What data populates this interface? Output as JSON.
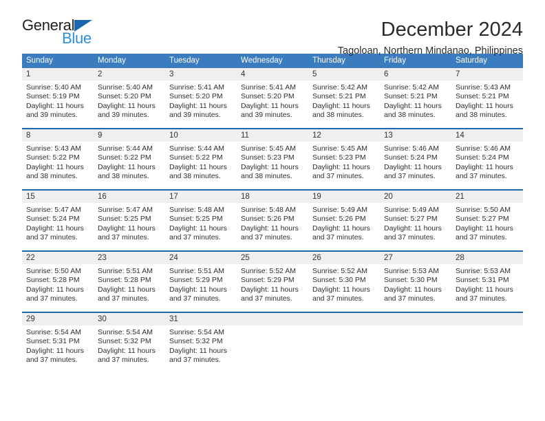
{
  "brand": {
    "name_top": "General",
    "name_bottom": "Blue",
    "triangle_icon": "triangle-icon",
    "color_dark": "#231f20",
    "color_blue": "#2c8fd4",
    "color_triangle": "#1c66ad"
  },
  "header": {
    "title": "December 2024",
    "subtitle": "Tagoloan, Northern Mindanao, Philippines"
  },
  "theme": {
    "header_bg": "#3a7cbd",
    "header_text": "#ffffff",
    "row_rule": "#1c66ad",
    "daynum_bg": "#efefef",
    "cell_bg": "#ffffff"
  },
  "calendar": {
    "weekdays": [
      "Sunday",
      "Monday",
      "Tuesday",
      "Wednesday",
      "Thursday",
      "Friday",
      "Saturday"
    ],
    "weeks": [
      [
        {
          "day": "1",
          "sunrise": "Sunrise: 5:40 AM",
          "sunset": "Sunset: 5:19 PM",
          "daylight_1": "Daylight: 11 hours",
          "daylight_2": "and 39 minutes."
        },
        {
          "day": "2",
          "sunrise": "Sunrise: 5:40 AM",
          "sunset": "Sunset: 5:20 PM",
          "daylight_1": "Daylight: 11 hours",
          "daylight_2": "and 39 minutes."
        },
        {
          "day": "3",
          "sunrise": "Sunrise: 5:41 AM",
          "sunset": "Sunset: 5:20 PM",
          "daylight_1": "Daylight: 11 hours",
          "daylight_2": "and 39 minutes."
        },
        {
          "day": "4",
          "sunrise": "Sunrise: 5:41 AM",
          "sunset": "Sunset: 5:20 PM",
          "daylight_1": "Daylight: 11 hours",
          "daylight_2": "and 39 minutes."
        },
        {
          "day": "5",
          "sunrise": "Sunrise: 5:42 AM",
          "sunset": "Sunset: 5:21 PM",
          "daylight_1": "Daylight: 11 hours",
          "daylight_2": "and 38 minutes."
        },
        {
          "day": "6",
          "sunrise": "Sunrise: 5:42 AM",
          "sunset": "Sunset: 5:21 PM",
          "daylight_1": "Daylight: 11 hours",
          "daylight_2": "and 38 minutes."
        },
        {
          "day": "7",
          "sunrise": "Sunrise: 5:43 AM",
          "sunset": "Sunset: 5:21 PM",
          "daylight_1": "Daylight: 11 hours",
          "daylight_2": "and 38 minutes."
        }
      ],
      [
        {
          "day": "8",
          "sunrise": "Sunrise: 5:43 AM",
          "sunset": "Sunset: 5:22 PM",
          "daylight_1": "Daylight: 11 hours",
          "daylight_2": "and 38 minutes."
        },
        {
          "day": "9",
          "sunrise": "Sunrise: 5:44 AM",
          "sunset": "Sunset: 5:22 PM",
          "daylight_1": "Daylight: 11 hours",
          "daylight_2": "and 38 minutes."
        },
        {
          "day": "10",
          "sunrise": "Sunrise: 5:44 AM",
          "sunset": "Sunset: 5:22 PM",
          "daylight_1": "Daylight: 11 hours",
          "daylight_2": "and 38 minutes."
        },
        {
          "day": "11",
          "sunrise": "Sunrise: 5:45 AM",
          "sunset": "Sunset: 5:23 PM",
          "daylight_1": "Daylight: 11 hours",
          "daylight_2": "and 38 minutes."
        },
        {
          "day": "12",
          "sunrise": "Sunrise: 5:45 AM",
          "sunset": "Sunset: 5:23 PM",
          "daylight_1": "Daylight: 11 hours",
          "daylight_2": "and 37 minutes."
        },
        {
          "day": "13",
          "sunrise": "Sunrise: 5:46 AM",
          "sunset": "Sunset: 5:24 PM",
          "daylight_1": "Daylight: 11 hours",
          "daylight_2": "and 37 minutes."
        },
        {
          "day": "14",
          "sunrise": "Sunrise: 5:46 AM",
          "sunset": "Sunset: 5:24 PM",
          "daylight_1": "Daylight: 11 hours",
          "daylight_2": "and 37 minutes."
        }
      ],
      [
        {
          "day": "15",
          "sunrise": "Sunrise: 5:47 AM",
          "sunset": "Sunset: 5:24 PM",
          "daylight_1": "Daylight: 11 hours",
          "daylight_2": "and 37 minutes."
        },
        {
          "day": "16",
          "sunrise": "Sunrise: 5:47 AM",
          "sunset": "Sunset: 5:25 PM",
          "daylight_1": "Daylight: 11 hours",
          "daylight_2": "and 37 minutes."
        },
        {
          "day": "17",
          "sunrise": "Sunrise: 5:48 AM",
          "sunset": "Sunset: 5:25 PM",
          "daylight_1": "Daylight: 11 hours",
          "daylight_2": "and 37 minutes."
        },
        {
          "day": "18",
          "sunrise": "Sunrise: 5:48 AM",
          "sunset": "Sunset: 5:26 PM",
          "daylight_1": "Daylight: 11 hours",
          "daylight_2": "and 37 minutes."
        },
        {
          "day": "19",
          "sunrise": "Sunrise: 5:49 AM",
          "sunset": "Sunset: 5:26 PM",
          "daylight_1": "Daylight: 11 hours",
          "daylight_2": "and 37 minutes."
        },
        {
          "day": "20",
          "sunrise": "Sunrise: 5:49 AM",
          "sunset": "Sunset: 5:27 PM",
          "daylight_1": "Daylight: 11 hours",
          "daylight_2": "and 37 minutes."
        },
        {
          "day": "21",
          "sunrise": "Sunrise: 5:50 AM",
          "sunset": "Sunset: 5:27 PM",
          "daylight_1": "Daylight: 11 hours",
          "daylight_2": "and 37 minutes."
        }
      ],
      [
        {
          "day": "22",
          "sunrise": "Sunrise: 5:50 AM",
          "sunset": "Sunset: 5:28 PM",
          "daylight_1": "Daylight: 11 hours",
          "daylight_2": "and 37 minutes."
        },
        {
          "day": "23",
          "sunrise": "Sunrise: 5:51 AM",
          "sunset": "Sunset: 5:28 PM",
          "daylight_1": "Daylight: 11 hours",
          "daylight_2": "and 37 minutes."
        },
        {
          "day": "24",
          "sunrise": "Sunrise: 5:51 AM",
          "sunset": "Sunset: 5:29 PM",
          "daylight_1": "Daylight: 11 hours",
          "daylight_2": "and 37 minutes."
        },
        {
          "day": "25",
          "sunrise": "Sunrise: 5:52 AM",
          "sunset": "Sunset: 5:29 PM",
          "daylight_1": "Daylight: 11 hours",
          "daylight_2": "and 37 minutes."
        },
        {
          "day": "26",
          "sunrise": "Sunrise: 5:52 AM",
          "sunset": "Sunset: 5:30 PM",
          "daylight_1": "Daylight: 11 hours",
          "daylight_2": "and 37 minutes."
        },
        {
          "day": "27",
          "sunrise": "Sunrise: 5:53 AM",
          "sunset": "Sunset: 5:30 PM",
          "daylight_1": "Daylight: 11 hours",
          "daylight_2": "and 37 minutes."
        },
        {
          "day": "28",
          "sunrise": "Sunrise: 5:53 AM",
          "sunset": "Sunset: 5:31 PM",
          "daylight_1": "Daylight: 11 hours",
          "daylight_2": "and 37 minutes."
        }
      ],
      [
        {
          "day": "29",
          "sunrise": "Sunrise: 5:54 AM",
          "sunset": "Sunset: 5:31 PM",
          "daylight_1": "Daylight: 11 hours",
          "daylight_2": "and 37 minutes."
        },
        {
          "day": "30",
          "sunrise": "Sunrise: 5:54 AM",
          "sunset": "Sunset: 5:32 PM",
          "daylight_1": "Daylight: 11 hours",
          "daylight_2": "and 37 minutes."
        },
        {
          "day": "31",
          "sunrise": "Sunrise: 5:54 AM",
          "sunset": "Sunset: 5:32 PM",
          "daylight_1": "Daylight: 11 hours",
          "daylight_2": "and 37 minutes."
        },
        {
          "day": "",
          "sunrise": "",
          "sunset": "",
          "daylight_1": "",
          "daylight_2": ""
        },
        {
          "day": "",
          "sunrise": "",
          "sunset": "",
          "daylight_1": "",
          "daylight_2": ""
        },
        {
          "day": "",
          "sunrise": "",
          "sunset": "",
          "daylight_1": "",
          "daylight_2": ""
        },
        {
          "day": "",
          "sunrise": "",
          "sunset": "",
          "daylight_1": "",
          "daylight_2": ""
        }
      ]
    ]
  }
}
